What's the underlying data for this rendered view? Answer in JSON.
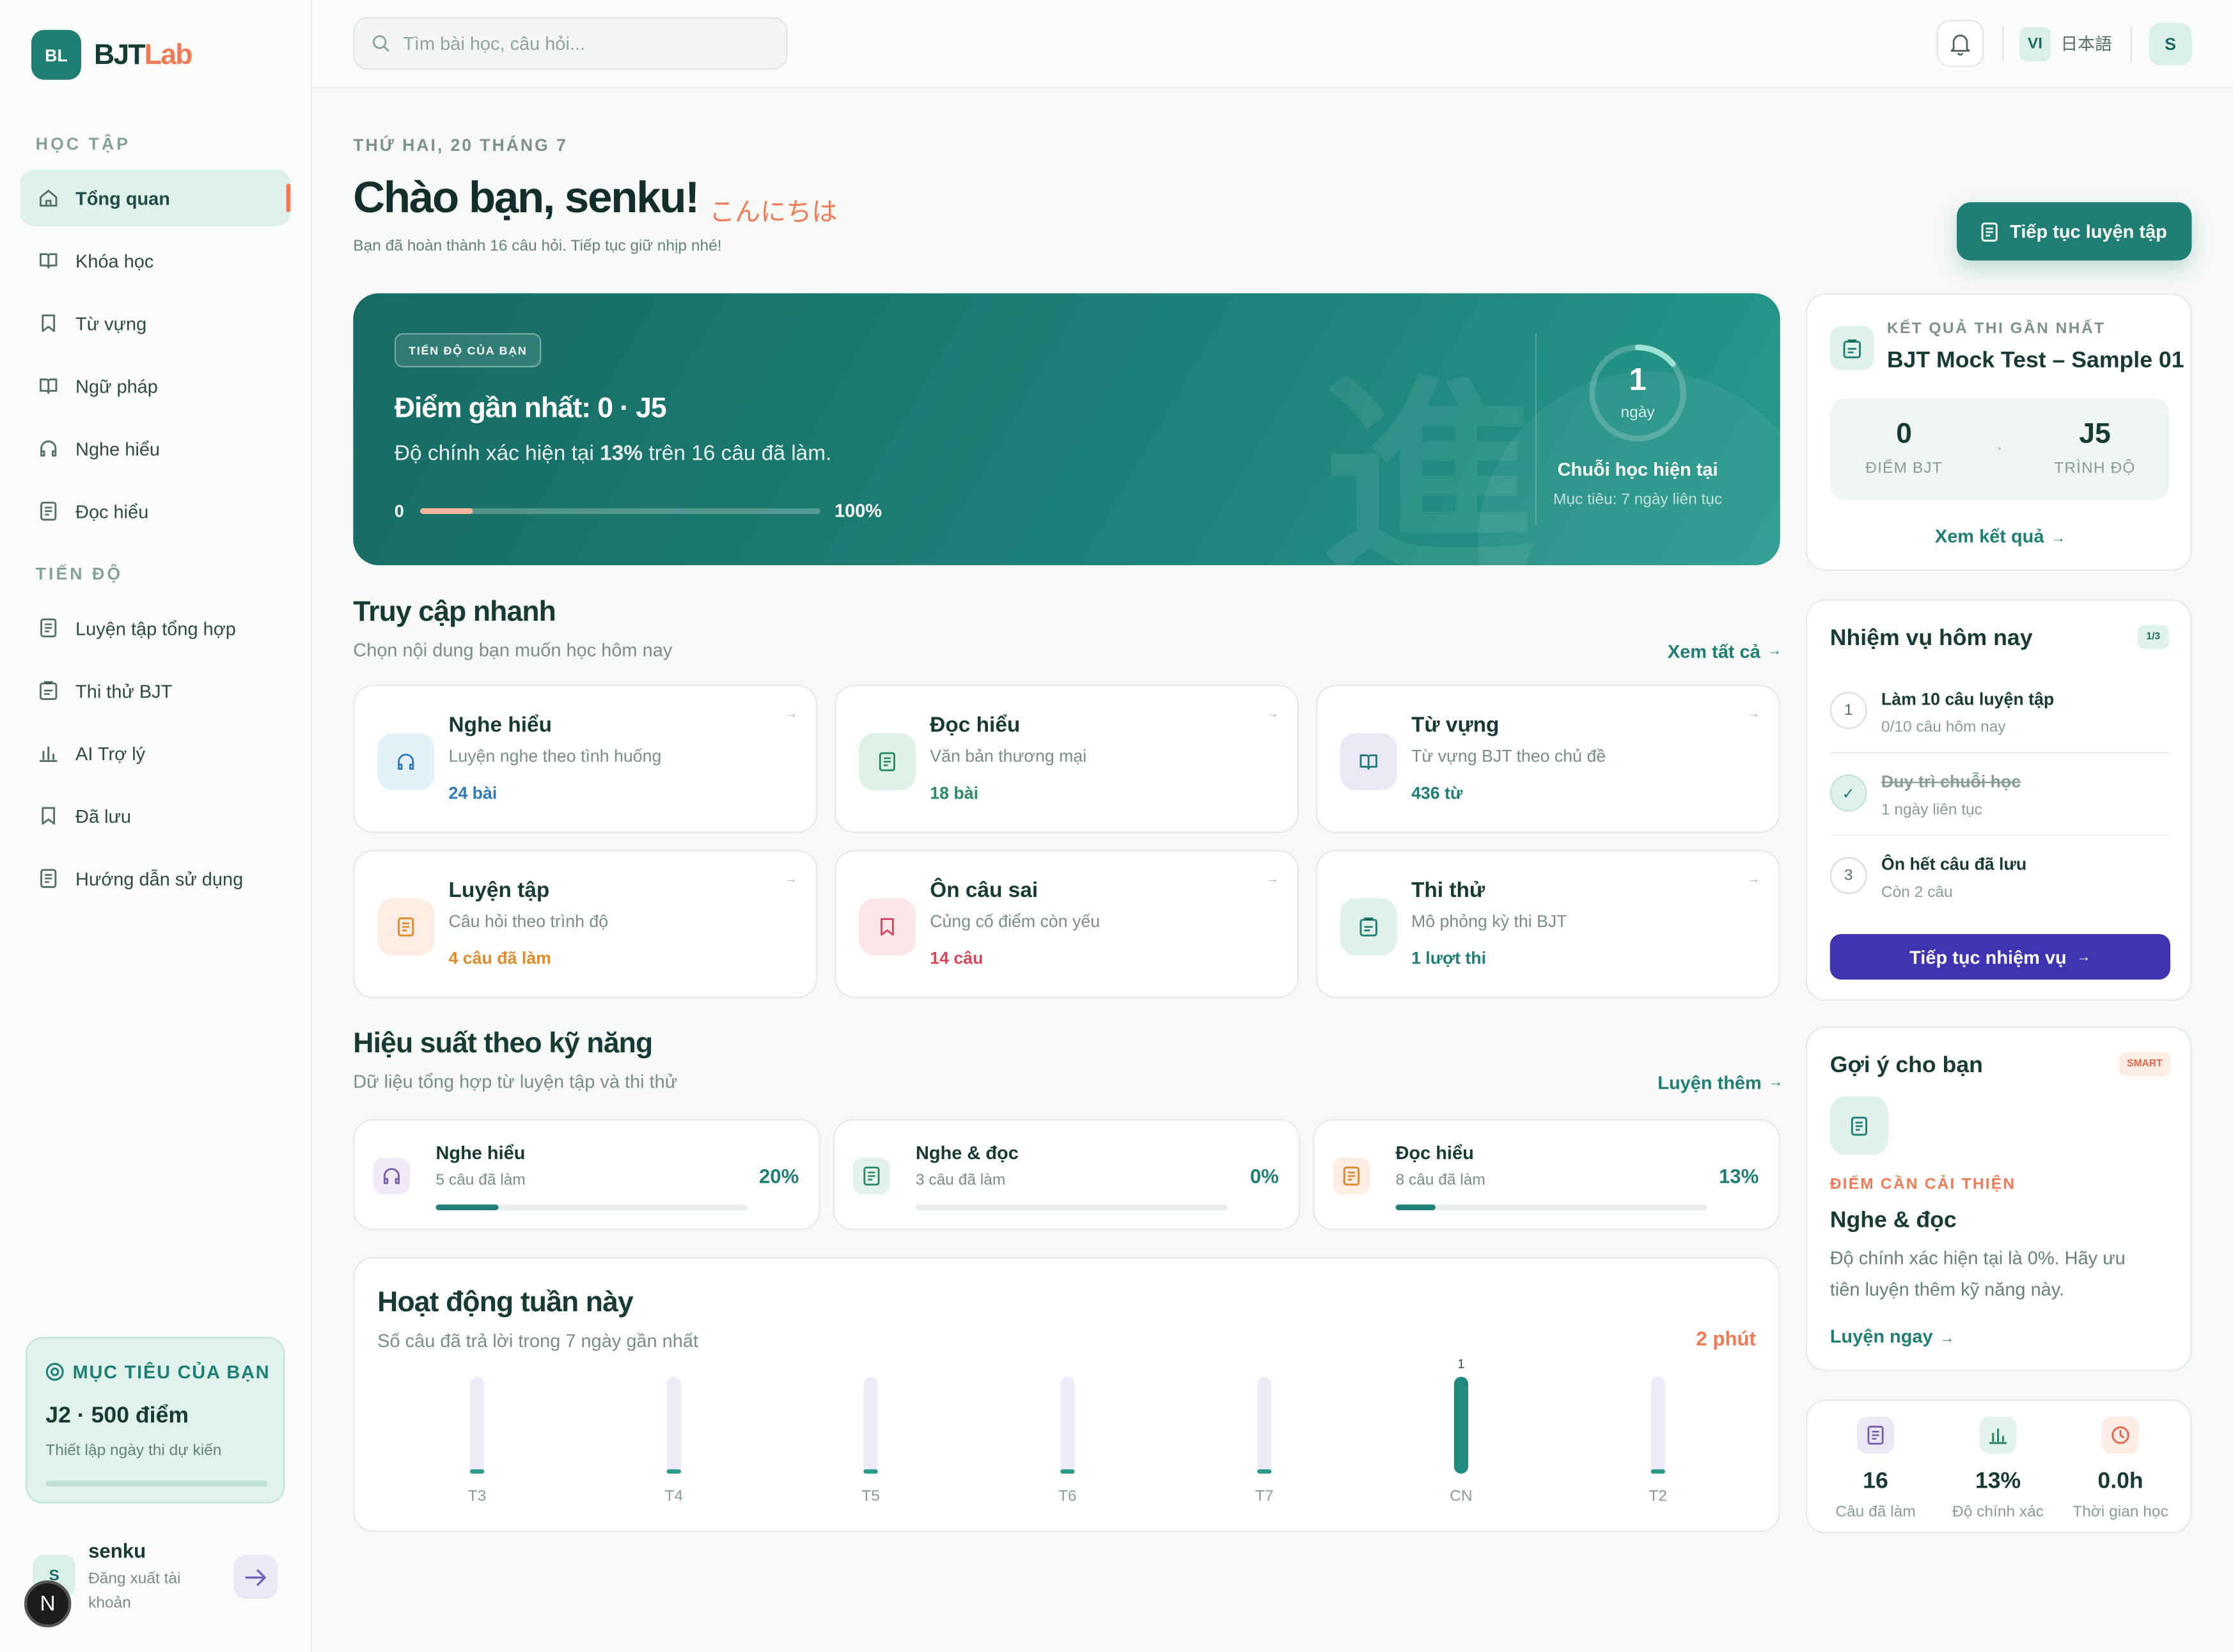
{
  "brand": {
    "badge": "BL",
    "name_a": "BJT",
    "name_b": "Lab",
    "accent": "#1f7f74",
    "coral": "#ef7a55"
  },
  "sidebar": {
    "section_study": "HỌC TẬP",
    "section_progress": "TIẾN ĐỘ",
    "study_items": [
      {
        "label": "Tổng quan",
        "icon": "home-icon",
        "active": true
      },
      {
        "label": "Khóa học",
        "icon": "book-open-icon"
      },
      {
        "label": "Từ vựng",
        "icon": "bookmark-icon"
      },
      {
        "label": "Ngữ pháp",
        "icon": "book-open-icon"
      },
      {
        "label": "Nghe hiểu",
        "icon": "headphones-icon"
      },
      {
        "label": "Đọc hiểu",
        "icon": "document-icon"
      }
    ],
    "progress_items": [
      {
        "label": "Luyện tập tổng hợp",
        "icon": "document-icon"
      },
      {
        "label": "Thi thử BJT",
        "icon": "clipboard-icon"
      },
      {
        "label": "AI Trợ lý",
        "icon": "bar-chart-icon"
      },
      {
        "label": "Đã lưu",
        "icon": "bookmark-icon"
      },
      {
        "label": "Hướng dẫn sử dụng",
        "icon": "document-icon"
      }
    ],
    "goal": {
      "title": "MỤC TIÊU CỦA BẠN",
      "value": "J2 · 500 điểm",
      "sub": "Thiết lập ngày thi dự kiến"
    },
    "user": {
      "name": "senku",
      "initial": "S",
      "logout": "Đăng xuất tài khoản",
      "badge": "N"
    }
  },
  "topbar": {
    "search_placeholder": "Tìm bài học, câu hỏi...",
    "lang_vi": "VI",
    "lang_ja": "日本語",
    "avatar": "S"
  },
  "header": {
    "date": "THỨ HAI, 20 THÁNG 7",
    "greeting": "Chào bạn, senku!",
    "greeting_jp": "こんにちは",
    "sub": "Bạn đã hoàn thành 16 câu hỏi. Tiếp tục giữ nhịp nhé!",
    "cta": "Tiếp tục luyện tập"
  },
  "hero": {
    "badge": "TIẾN ĐỘ CỦA BẠN",
    "title": "Điểm gần nhất: 0 · J5",
    "sub_pre": "Độ chính xác hiện tại ",
    "sub_pct": "13%",
    "sub_post": " trên 16 câu đã làm.",
    "min": "0",
    "max": "100%",
    "progress": 0.13,
    "watermark": "進",
    "streak_value": "1",
    "streak_unit": "ngày",
    "streak_title": "Chuỗi học hiện tại",
    "streak_sub": "Mục tiêu: 7 ngày liên tục",
    "streak_progress": 0.14
  },
  "quick": {
    "title": "Truy cập nhanh",
    "sub": "Chọn nội dung bạn muốn học hôm nay",
    "link": "Xem tất cả",
    "cards": [
      {
        "title": "Nghe hiểu",
        "sub": "Luyện nghe theo tình huống",
        "count": "24 bài",
        "icon": "headphones-icon",
        "color": "#2e7ab8",
        "bg": "#e3f0f8"
      },
      {
        "title": "Đọc hiểu",
        "sub": "Văn bản thương mại",
        "count": "18 bài",
        "icon": "document-icon",
        "color": "#2a8a62",
        "bg": "#def1e7"
      },
      {
        "title": "Từ vựng",
        "sub": "Từ vựng BJT theo chủ đề",
        "count": "436 từ",
        "icon": "book-open-icon",
        "color": "#1f7f74",
        "bg": "#ece7f5"
      },
      {
        "title": "Luyện tập",
        "sub": "Câu hỏi theo trình độ",
        "count": "4 câu đã làm",
        "icon": "document-icon",
        "color": "#e08a2a",
        "bg": "#fdece3"
      },
      {
        "title": "Ôn câu sai",
        "sub": "Củng cố điểm còn yếu",
        "count": "14 câu",
        "icon": "bookmark-icon",
        "color": "#d9465a",
        "bg": "#fbe6e8"
      },
      {
        "title": "Thi thử",
        "sub": "Mô phỏng kỳ thi BJT",
        "count": "1 lượt thi",
        "icon": "clipboard-icon",
        "color": "#1f7f74",
        "bg": "#dff1ea"
      }
    ]
  },
  "skills": {
    "title": "Hiệu suất theo kỹ năng",
    "sub": "Dữ liệu tổng hợp từ luyện tập và thi thử",
    "link": "Luyện thêm",
    "items": [
      {
        "title": "Nghe hiểu",
        "sub": "5 câu đã làm",
        "pct": "20%",
        "value": 0.2,
        "icon": "headphones-icon",
        "bg": "#f0ebf6",
        "color": "#7b5ea8"
      },
      {
        "title": "Nghe & đọc",
        "sub": "3 câu đã làm",
        "pct": "0%",
        "value": 0,
        "icon": "document-icon",
        "bg": "#e3f2ec",
        "color": "#2a8a62"
      },
      {
        "title": "Đọc hiểu",
        "sub": "8 câu đã làm",
        "pct": "13%",
        "value": 0.13,
        "icon": "document-icon",
        "bg": "#fdece3",
        "color": "#e08a2a"
      }
    ]
  },
  "activity": {
    "title": "Hoạt động tuần này",
    "sub": "Số câu đã trả lời trong 7 ngày gần nhất",
    "total": "2 phút",
    "chart_data": {
      "type": "bar",
      "categories": [
        "T3",
        "T4",
        "T5",
        "T6",
        "T7",
        "CN",
        "T2"
      ],
      "values": [
        0,
        0,
        0,
        0,
        0,
        1,
        0
      ],
      "data_labels": [
        "",
        "",
        "",
        "",
        "",
        "1",
        ""
      ],
      "ylim": [
        0,
        1
      ]
    }
  },
  "right": {
    "last_exam": {
      "label": "KẾT QUẢ THI GẦN NHẤT",
      "title": "BJT Mock Test – Sample 01",
      "score": "0",
      "score_label": "ĐIỂM BJT",
      "level": "J5",
      "level_label": "TRÌNH ĐỘ",
      "link": "Xem kết quả"
    },
    "tasks": {
      "title": "Nhiệm vụ hôm nay",
      "badge": "1/3",
      "items": [
        {
          "num": "1",
          "title": "Làm 10 câu luyện tập",
          "sub": "0/10 câu hôm nay",
          "done": false
        },
        {
          "num": "✓",
          "title": "Duy trì chuỗi học",
          "sub": "1 ngày liên tục",
          "done": true
        },
        {
          "num": "3",
          "title": "Ôn hết câu đã lưu",
          "sub": "Còn 2 câu",
          "done": false
        }
      ],
      "button": "Tiếp tục nhiệm vụ"
    },
    "suggest": {
      "title": "Gợi ý cho bạn",
      "badge": "SMART",
      "label": "ĐIỂM CẦN CẢI THIỆN",
      "skill": "Nghe & đọc",
      "desc": "Độ chính xác hiện tại là 0%. Hãy ưu tiên luyện thêm kỹ năng này.",
      "link": "Luyện ngay"
    },
    "stats": [
      {
        "value": "16",
        "label": "Câu đã làm",
        "icon": "document-icon",
        "bg": "#ece7f5",
        "color": "#7b5ea8"
      },
      {
        "value": "13%",
        "label": "Độ chính xác",
        "icon": "bar-chart-icon",
        "bg": "#e3f2ec",
        "color": "#2a8a62"
      },
      {
        "value": "0.0h",
        "label": "Thời gian học",
        "icon": "clock-icon",
        "bg": "#fdece3",
        "color": "#e0664a"
      }
    ]
  }
}
